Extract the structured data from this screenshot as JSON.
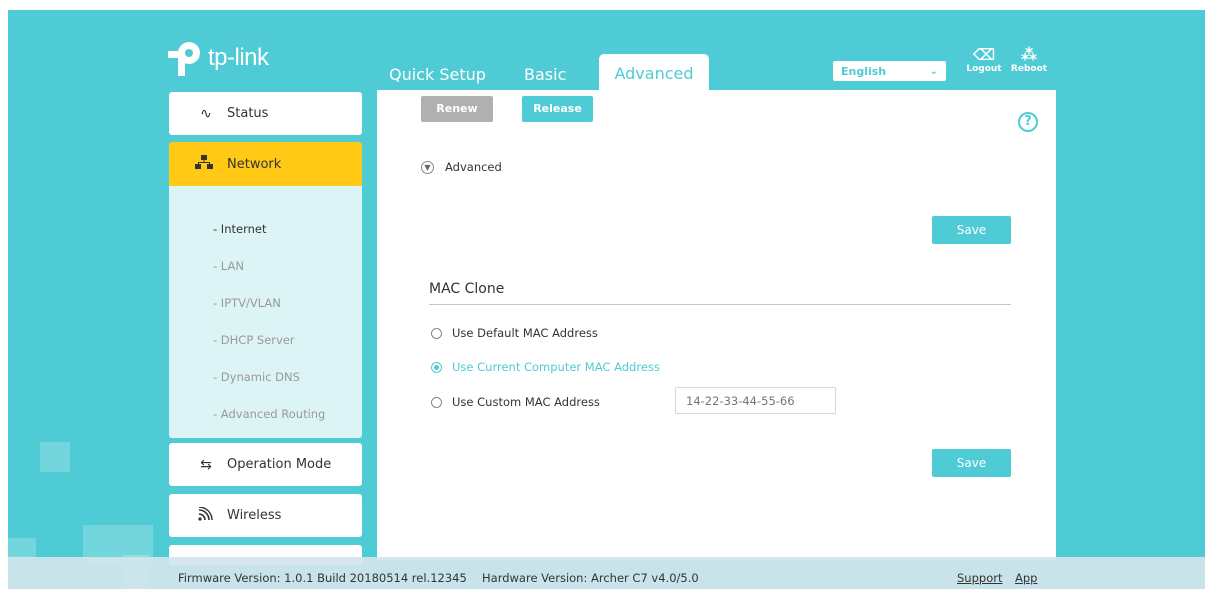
{
  "brand": {
    "name": "tp-link"
  },
  "tabs": [
    {
      "label": "Quick Setup"
    },
    {
      "label": "Basic"
    },
    {
      "label": "Advanced",
      "active": true
    }
  ],
  "language": {
    "selected": "English"
  },
  "header_actions": {
    "logout": "Logout",
    "reboot": "Reboot"
  },
  "sidebar": {
    "items": [
      {
        "label": "Status",
        "icon": "pulse-icon"
      },
      {
        "label": "Network",
        "icon": "network-icon",
        "active": true
      },
      {
        "label": "Operation Mode",
        "icon": "switch-mode-icon"
      },
      {
        "label": "Wireless",
        "icon": "wifi-icon"
      }
    ],
    "network_sub": [
      {
        "label": "- Internet",
        "active": true
      },
      {
        "label": "- LAN"
      },
      {
        "label": "- IPTV/VLAN"
      },
      {
        "label": "- DHCP Server"
      },
      {
        "label": "- Dynamic DNS"
      },
      {
        "label": "- Advanced Routing"
      }
    ]
  },
  "main": {
    "renew_label": "Renew",
    "release_label": "Release",
    "advanced_toggle": "Advanced",
    "save_label": "Save",
    "mac_clone": {
      "title": "MAC Clone",
      "options": [
        {
          "label": "Use Default MAC Address",
          "selected": false
        },
        {
          "label": "Use Current Computer MAC Address",
          "selected": true
        },
        {
          "label": "Use Custom MAC Address",
          "selected": false
        }
      ],
      "custom_mac_placeholder": "14-22-33-44-55-66"
    }
  },
  "footer": {
    "firmware": "Firmware Version: 1.0.1 Build 20180514 rel.12345",
    "hardware": "Hardware Version: Archer C7 v4.0/5.0",
    "support": "Support",
    "app": "App"
  },
  "colors": {
    "accent": "#4ecbd4",
    "active_nav": "#ffc915",
    "disabled_button": "#b0b0b0"
  }
}
